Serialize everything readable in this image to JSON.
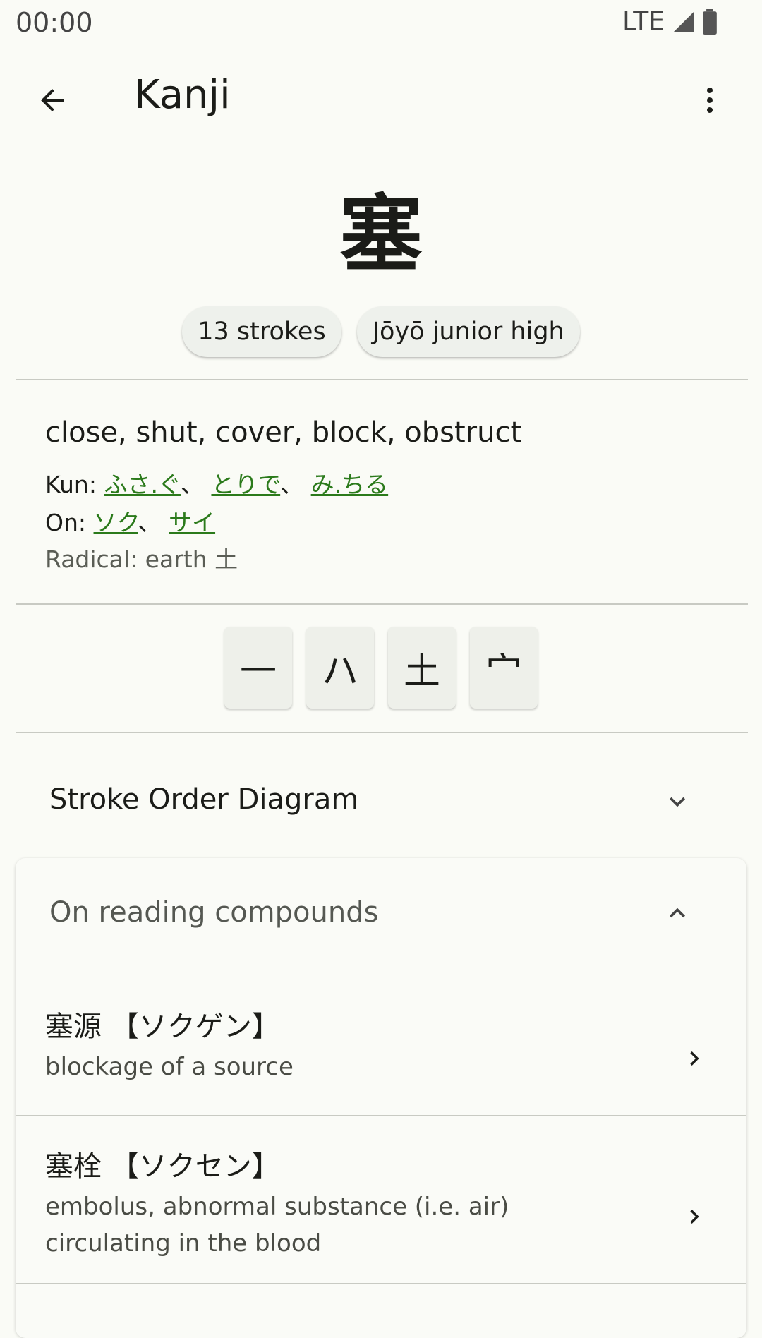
{
  "status_bar": {
    "time": "00:00",
    "network": "LTE"
  },
  "app_bar": {
    "title": "Kanji"
  },
  "kanji": {
    "character": "塞",
    "strokes": "13 strokes",
    "grade": "Jōyō junior high"
  },
  "details": {
    "meanings": "close, shut, cover, block, obstruct",
    "kun_label": "Kun:",
    "kun": [
      "ふさ.ぐ",
      "とりで",
      "み.ちる"
    ],
    "on_label": "On:",
    "on": [
      "ソク",
      "サイ"
    ],
    "separator": "、",
    "radical": "Radical: earth 土"
  },
  "radicals": [
    "一",
    "ハ",
    "土",
    "宀"
  ],
  "stroke_order": {
    "title": "Stroke Order Diagram"
  },
  "compounds": {
    "title": "On reading compounds",
    "items": [
      {
        "word": "塞源 【ソクゲン】",
        "meaning": "blockage of a source"
      },
      {
        "word": "塞栓 【ソクセン】",
        "meaning": "embolus, abnormal substance (i.e. air) circulating in the blood"
      }
    ]
  },
  "colors": {
    "link": "#2b7a1b",
    "background": "#fafbf6",
    "chip": "#eef1ec"
  }
}
